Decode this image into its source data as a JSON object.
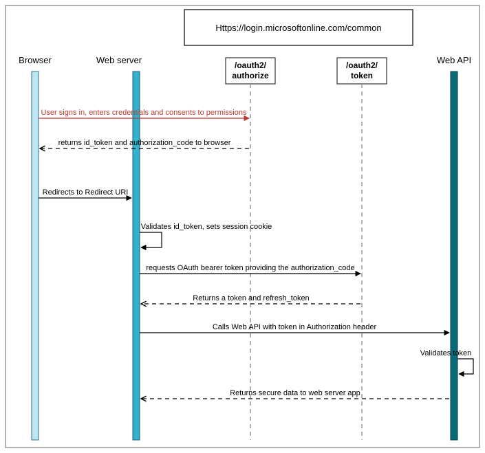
{
  "header_url": "Https://login.microsoftonline.com/common",
  "actors": {
    "browser": "Browser",
    "webserver": "Web server",
    "authorize": [
      "/oauth2/",
      "authorize"
    ],
    "token": [
      "/oauth2/",
      "token"
    ],
    "webapi": "Web API"
  },
  "messages": {
    "m1": "User signs in, enters credentials and consents to permissions",
    "m2": "returns id_token and authorization_code to browser",
    "m3": "Redirects to Redirect URI",
    "m4": "Validates id_token, sets session cookie",
    "m5": "requests OAuth bearer token providing the authorization_code",
    "m6": "Returns a token and refresh_token",
    "m7": "Calls Web API with token in Authorization header",
    "m8": "Validates token",
    "m9": "Returns secure data to web server app"
  }
}
